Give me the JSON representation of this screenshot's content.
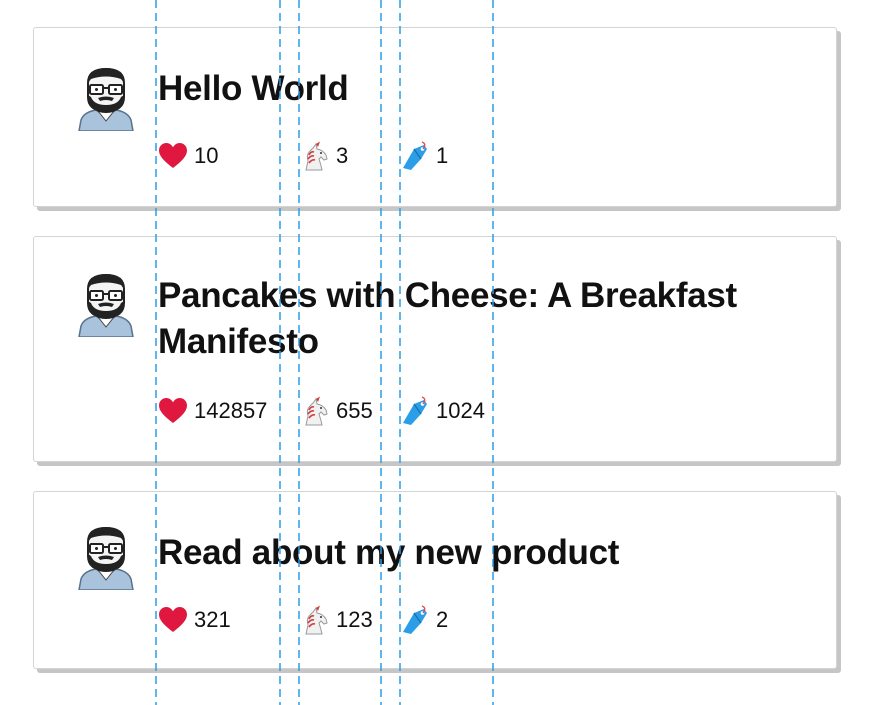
{
  "posts": [
    {
      "title": "Hello World",
      "hearts": "10",
      "unicorns": "3",
      "bookmarks": "1"
    },
    {
      "title": "Pancakes with Cheese: A Breakfast Manifesto",
      "hearts": "142857",
      "unicorns": "655",
      "bookmarks": "1024"
    },
    {
      "title": "Read about my new product",
      "hearts": "321",
      "unicorns": "123",
      "bookmarks": "2"
    }
  ],
  "icons": {
    "avatar": "bearded-man-avatar-icon",
    "hearts": "heart-icon",
    "unicorns": "unicorn-icon",
    "bookmarks": "bookmark-icon"
  },
  "colors": {
    "heart": "#e0183f",
    "bookmark": "#2a9ee6",
    "guide": "#2a9ee6",
    "card_border": "#d4d4d4",
    "card_shadow": "#c6c6c6"
  }
}
